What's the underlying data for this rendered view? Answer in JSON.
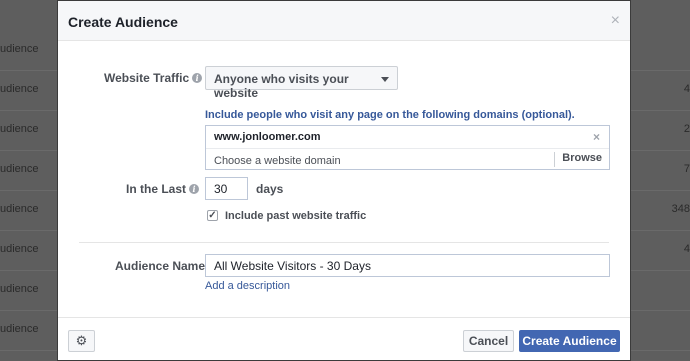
{
  "background": {
    "rows": [
      {
        "left": "udience",
        "right": ""
      },
      {
        "left": "udience",
        "right": "4"
      },
      {
        "left": "udience",
        "right": "2"
      },
      {
        "left": "udience",
        "right": "7"
      },
      {
        "left": "udience",
        "right": "348"
      },
      {
        "left": "udience",
        "right": "4"
      },
      {
        "left": "udience",
        "right": ""
      },
      {
        "left": "udience",
        "right": ""
      }
    ]
  },
  "modal": {
    "title": "Create Audience",
    "close_glyph": "×"
  },
  "form": {
    "website_traffic_label": "Website Traffic",
    "info_glyph": "i",
    "traffic_option": "Anyone who visits your website",
    "domains_hint": "Include people who visit any page on the following domains (optional).",
    "domain_value": "www.jonloomer.com",
    "domain_remove_glyph": "×",
    "domain_placeholder": "Choose a website domain",
    "browse_label": "Browse",
    "in_the_last_label": "In the Last",
    "days_value": "30",
    "days_unit": "days",
    "include_past_checked": true,
    "checkbox_glyph": "✓",
    "include_past_label": "Include past website traffic",
    "audience_name_label": "Audience Name",
    "audience_name_value": "All Website Visitors - 30 Days",
    "add_description": "Add a description"
  },
  "footer": {
    "gear_glyph": "⚙",
    "cancel_label": "Cancel",
    "create_label": "Create Audience"
  },
  "colors": {
    "primary": "#4267b2",
    "link": "#365899",
    "border": "#bdc7d8",
    "overlay": "#5e5e5e"
  }
}
